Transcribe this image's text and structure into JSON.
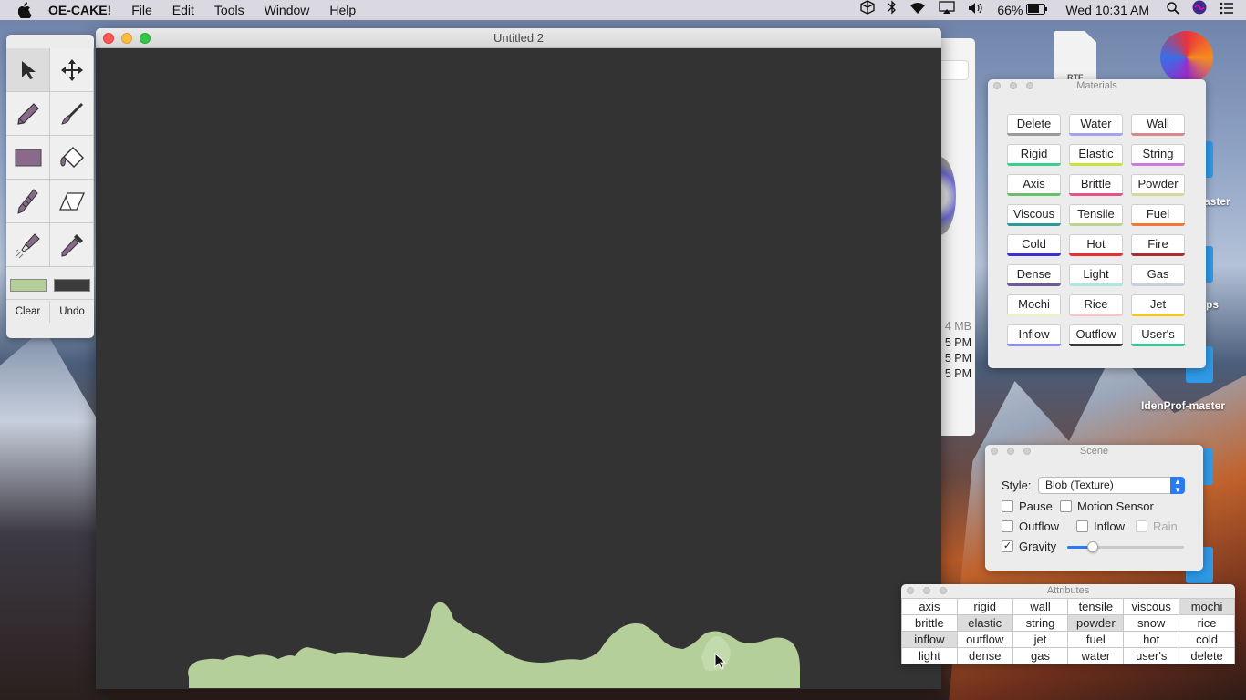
{
  "menubar": {
    "app_name": "OE-CAKE!",
    "menus": [
      "File",
      "Edit",
      "Tools",
      "Window",
      "Help"
    ],
    "battery": "66%",
    "clock": "Wed 10:31 AM"
  },
  "desktop": {
    "labels": [
      "aster",
      "ps",
      "IdenProf-master"
    ],
    "file_icon_label": "RTF"
  },
  "finder_behind": {
    "size": "4 MB",
    "times": [
      "5 PM",
      "5 PM",
      "5 PM"
    ]
  },
  "tools": {
    "clear_label": "Clear",
    "undo_label": "Undo",
    "color1": "#b5cf9b",
    "color2": "#3c3c3c"
  },
  "main_window": {
    "title": "Untitled 2"
  },
  "materials": {
    "title": "Materials",
    "items": [
      {
        "label": "Delete",
        "color": "#9a9a9a"
      },
      {
        "label": "Water",
        "color": "#a4a4ee"
      },
      {
        "label": "Wall",
        "color": "#d88a8a"
      },
      {
        "label": "Rigid",
        "color": "#38d08a"
      },
      {
        "label": "Elastic",
        "color": "#c8e040"
      },
      {
        "label": "String",
        "color": "#cf7ae0"
      },
      {
        "label": "Axis",
        "color": "#6ac06a"
      },
      {
        "label": "Brittle",
        "color": "#e8508a"
      },
      {
        "label": "Powder",
        "color": "#d6d6a0"
      },
      {
        "label": "Viscous",
        "color": "#2a9a9a"
      },
      {
        "label": "Tensile",
        "color": "#bcd48e"
      },
      {
        "label": "Fuel",
        "color": "#f07a30"
      },
      {
        "label": "Cold",
        "color": "#3a30d0"
      },
      {
        "label": "Hot",
        "color": "#e83030"
      },
      {
        "label": "Fire",
        "color": "#a83030"
      },
      {
        "label": "Dense",
        "color": "#6a5a9a"
      },
      {
        "label": "Light",
        "color": "#a8e8e0"
      },
      {
        "label": "Gas",
        "color": "#c8d0e0"
      },
      {
        "label": "Mochi",
        "color": "#f0f0c8"
      },
      {
        "label": "Rice",
        "color": "#f0c8cc"
      },
      {
        "label": "Jet",
        "color": "#f0c820"
      },
      {
        "label": "Inflow",
        "color": "#8c8cf0"
      },
      {
        "label": "Outflow",
        "color": "#3a3a3a"
      },
      {
        "label": "User's",
        "color": "#30c890"
      }
    ]
  },
  "scene": {
    "title": "Scene",
    "style_label": "Style:",
    "style_value": "Blob (Texture)",
    "pause_label": "Pause",
    "motion_label": "Motion Sensor",
    "outflow_label": "Outflow",
    "inflow_label": "Inflow",
    "rain_label": "Rain",
    "gravity_label": "Gravity",
    "gravity_checked": true,
    "gravity_level": 0.22
  },
  "attributes": {
    "title": "Attributes",
    "rows": [
      [
        "axis",
        "rigid",
        "wall",
        "tensile",
        "viscous",
        "mochi"
      ],
      [
        "brittle",
        "elastic",
        "string",
        "powder",
        "snow",
        "rice"
      ],
      [
        "inflow",
        "outflow",
        "jet",
        "fuel",
        "hot",
        "cold"
      ],
      [
        "light",
        "dense",
        "gas",
        "water",
        "user's",
        "delete"
      ]
    ],
    "highlighted": [
      "mochi",
      "elastic",
      "powder",
      "inflow"
    ]
  }
}
